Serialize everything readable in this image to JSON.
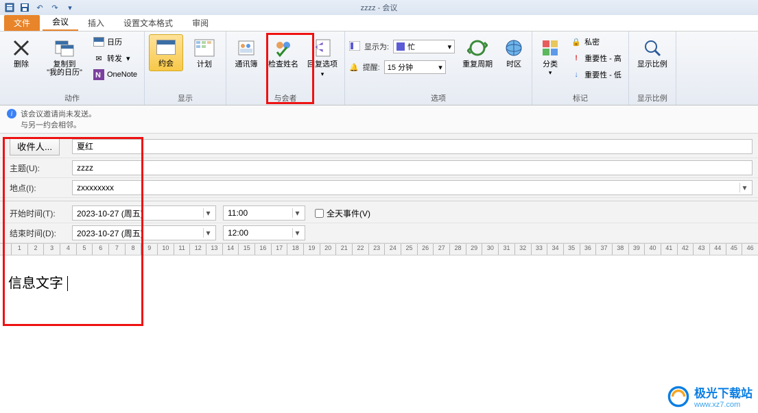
{
  "title": "zzzz - 会议",
  "tabs": {
    "file": "文件",
    "meeting": "会议",
    "insert": "插入",
    "format": "设置文本格式",
    "review": "审阅"
  },
  "ribbon": {
    "actions": {
      "delete": "删除",
      "copy_to": "复制到\n\"我的日历\"",
      "calendar": "日历",
      "forward": "转发",
      "onenote": "OneNote",
      "group_label": "动作"
    },
    "show": {
      "appointment": "约会",
      "schedule": "计划",
      "group_label": "显示"
    },
    "attendees": {
      "address_book": "通讯簿",
      "check_names": "检查姓名",
      "response_options": "回复选项",
      "group_label": "与会者"
    },
    "options": {
      "show_as_label": "显示为:",
      "show_as_value": "忙",
      "reminder_label": "提醒:",
      "reminder_value": "15 分钟",
      "recurrence": "重复周期",
      "timezone": "时区",
      "group_label": "选项"
    },
    "tags": {
      "categorize": "分类",
      "private": "私密",
      "importance_high": "重要性 - 高",
      "importance_low": "重要性 - 低",
      "group_label": "标记"
    },
    "zoom": {
      "zoom": "显示比例",
      "group_label": "显示比例"
    }
  },
  "info": {
    "line1": "该会议邀请尚未发送。",
    "line2": "与另一约会相邻。"
  },
  "form": {
    "to_button": "收件人...",
    "to_value": "夏红",
    "subject_label": "主题(U):",
    "subject_value": "zzzz",
    "location_label": "地点(I):",
    "location_value": "zxxxxxxxx",
    "start_label": "开始时间(T):",
    "start_date": "2023-10-27 (周五)",
    "start_time": "11:00",
    "end_label": "结束时间(D):",
    "end_date": "2023-10-27 (周五)",
    "end_time": "12:00",
    "allday_label": "全天事件(V)"
  },
  "body": "信息文字",
  "watermark": {
    "name": "极光下载站",
    "url": "www.xz7.com"
  }
}
